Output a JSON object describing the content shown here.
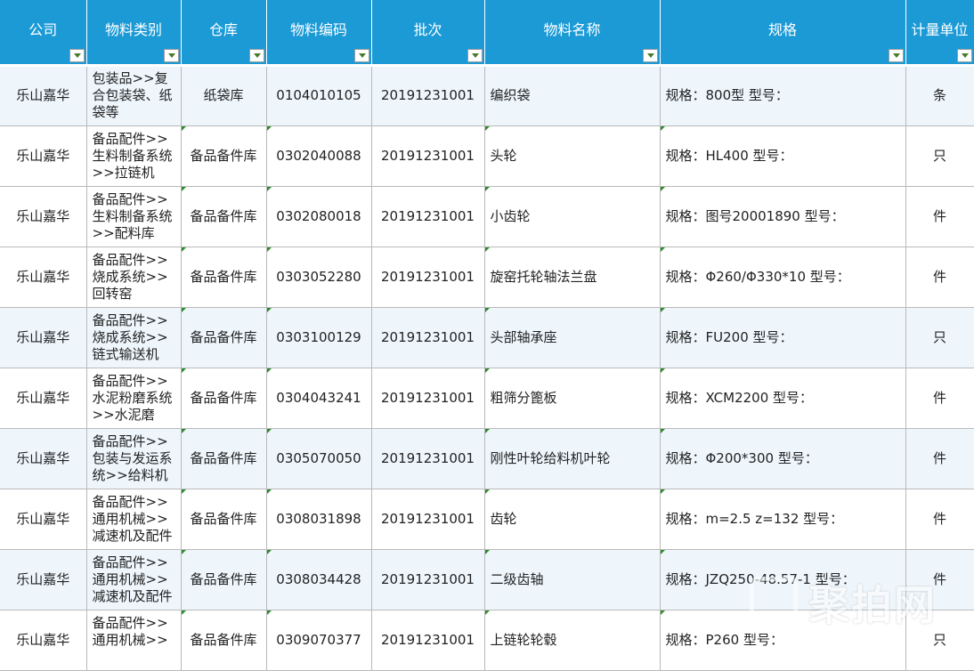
{
  "headers": [
    "公司",
    "物料类别",
    "仓库",
    "物料编码",
    "批次",
    "物料名称",
    "规格",
    "计量单位"
  ],
  "rows": [
    {
      "company": "乐山嘉华",
      "category": "包装品>>复合包装袋、纸袋等",
      "warehouse": "纸袋库",
      "code": "0104010105",
      "batch": "20191231001",
      "name": "编织袋",
      "spec": "规格：800型 型号：",
      "unit": "条"
    },
    {
      "company": "乐山嘉华",
      "category": "备品配件>>生料制备系统>>拉链机",
      "warehouse": "备品备件库",
      "code": "0302040088",
      "batch": "20191231001",
      "name": "头轮",
      "spec": "规格：HL400 型号：",
      "unit": "只"
    },
    {
      "company": "乐山嘉华",
      "category": "备品配件>>生料制备系统>>配料库",
      "warehouse": "备品备件库",
      "code": "0302080018",
      "batch": "20191231001",
      "name": "小齿轮",
      "spec": "规格：图号20001890 型号：",
      "unit": "件"
    },
    {
      "company": "乐山嘉华",
      "category": "备品配件>>烧成系统>>回转窑",
      "warehouse": "备品备件库",
      "code": "0303052280",
      "batch": "20191231001",
      "name": "旋窑托轮轴法兰盘",
      "spec": "规格：Φ260/Φ330*10 型号：",
      "unit": "件"
    },
    {
      "company": "乐山嘉华",
      "category": "备品配件>>烧成系统>>链式输送机",
      "warehouse": "备品备件库",
      "code": "0303100129",
      "batch": "20191231001",
      "name": "头部轴承座",
      "spec": "规格：FU200 型号：",
      "unit": "只"
    },
    {
      "company": "乐山嘉华",
      "category": "备品配件>>水泥粉磨系统>>水泥磨",
      "warehouse": "备品备件库",
      "code": "0304043241",
      "batch": "20191231001",
      "name": "粗筛分篦板",
      "spec": "规格：XCM2200 型号：",
      "unit": "件"
    },
    {
      "company": "乐山嘉华",
      "category": "备品配件>>包装与发运系统>>给料机",
      "warehouse": "备品备件库",
      "code": "0305070050",
      "batch": "20191231001",
      "name": "刚性叶轮给料机叶轮",
      "spec": "规格：Φ200*300 型号：",
      "unit": "件"
    },
    {
      "company": "乐山嘉华",
      "category": "备品配件>>通用机械>>减速机及配件",
      "warehouse": "备品备件库",
      "code": "0308031898",
      "batch": "20191231001",
      "name": "齿轮",
      "spec": "规格：m=2.5 z=132 型号：",
      "unit": "件"
    },
    {
      "company": "乐山嘉华",
      "category": "备品配件>>通用机械>>减速机及配件",
      "warehouse": "备品备件库",
      "code": "0308034428",
      "batch": "20191231001",
      "name": "二级齿轴",
      "spec": "规格：JZQ250-48.57-1 型号：",
      "unit": "件"
    },
    {
      "company": "乐山嘉华",
      "category": "备品配件>>通用机械>>",
      "warehouse": "备品备件库",
      "code": "0309070377",
      "batch": "20191231001",
      "name": "上链轮轮毂",
      "spec": "规格：P260 型号：",
      "unit": "只"
    }
  ],
  "watermark": "聚拍网",
  "colors": {
    "header_bg": "#1b9ad6",
    "row_alt": "#eef6fc"
  }
}
